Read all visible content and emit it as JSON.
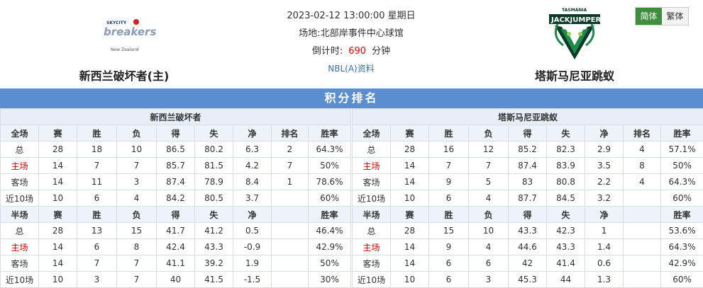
{
  "match": {
    "datetime": "2023-02-12 13:00:00 星期日",
    "venue_label": "场地:",
    "venue": "北部岸事件中心球馆",
    "countdown_label": "倒计时:",
    "countdown_value": "690",
    "countdown_unit": "分钟",
    "link": "NBL(A)资料"
  },
  "home": {
    "name": "新西兰破坏者(主)",
    "logo_text": "breakers",
    "logo_sub": "New Zealand",
    "logo_brand": "SKYCITY"
  },
  "away": {
    "name": "塔斯马尼亚跳蚁",
    "logo_text": "JACKJUMPERS",
    "logo_brand": "TASMANIA"
  },
  "lang": {
    "simplified": "简体",
    "traditional": "繁体"
  },
  "banner": "积分排名",
  "tables": {
    "home": {
      "title": "新西兰破坏者",
      "full_header": [
        "全场",
        "赛",
        "胜",
        "负",
        "得",
        "失",
        "净",
        "排名",
        "胜率"
      ],
      "full_rows": [
        [
          "总",
          "28",
          "18",
          "10",
          "86.5",
          "80.2",
          "6.3",
          "2",
          "64.3%"
        ],
        [
          "主场",
          "14",
          "7",
          "7",
          "85.7",
          "81.5",
          "4.2",
          "7",
          "50%"
        ],
        [
          "客场",
          "14",
          "11",
          "3",
          "87.4",
          "78.9",
          "8.4",
          "1",
          "78.6%"
        ],
        [
          "近10场",
          "10",
          "6",
          "4",
          "84.2",
          "80.5",
          "3.7",
          "",
          "60%"
        ]
      ],
      "half_header": [
        "半场",
        "赛",
        "胜",
        "负",
        "得",
        "失",
        "净",
        "",
        "胜率"
      ],
      "half_rows": [
        [
          "总",
          "28",
          "13",
          "15",
          "41.7",
          "41.2",
          "0.5",
          "",
          "46.4%"
        ],
        [
          "主场",
          "14",
          "6",
          "8",
          "42.4",
          "43.3",
          "-0.9",
          "",
          "42.9%"
        ],
        [
          "客场",
          "14",
          "7",
          "7",
          "41.1",
          "39.2",
          "1.9",
          "",
          "50%"
        ],
        [
          "近10场",
          "10",
          "3",
          "7",
          "40",
          "41.5",
          "-1.5",
          "",
          "30%"
        ]
      ]
    },
    "away": {
      "title": "塔斯马尼亚跳蚁",
      "full_header": [
        "全场",
        "赛",
        "胜",
        "负",
        "得",
        "失",
        "净",
        "排名",
        "胜率"
      ],
      "full_rows": [
        [
          "总",
          "28",
          "16",
          "12",
          "85.2",
          "82.3",
          "2.9",
          "4",
          "57.1%"
        ],
        [
          "主场",
          "14",
          "7",
          "7",
          "87.4",
          "83.9",
          "3.5",
          "8",
          "50%"
        ],
        [
          "客场",
          "14",
          "9",
          "5",
          "83",
          "80.8",
          "2.2",
          "4",
          "64.3%"
        ],
        [
          "近10场",
          "10",
          "6",
          "4",
          "87.7",
          "84.5",
          "3.2",
          "",
          "60%"
        ]
      ],
      "half_header": [
        "半场",
        "赛",
        "胜",
        "负",
        "得",
        "失",
        "净",
        "",
        "胜率"
      ],
      "half_rows": [
        [
          "总",
          "28",
          "15",
          "10",
          "43.3",
          "42.3",
          "1",
          "",
          "53.6%"
        ],
        [
          "主场",
          "14",
          "9",
          "4",
          "44.6",
          "43.3",
          "1.4",
          "",
          "64.3%"
        ],
        [
          "客场",
          "14",
          "6",
          "6",
          "42",
          "41.4",
          "0.6",
          "",
          "42.9%"
        ],
        [
          "近10场",
          "10",
          "6",
          "3",
          "45.3",
          "44",
          "1.3",
          "",
          "60%"
        ]
      ]
    }
  },
  "colors": {
    "banner": "#5a8ed0",
    "home_highlight": "#dd0000",
    "lang_active": "#3e8e3e"
  }
}
